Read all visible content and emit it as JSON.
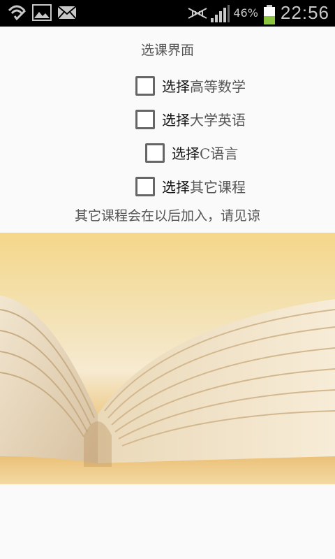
{
  "status_bar": {
    "battery_percent": "46%",
    "time": "22:56",
    "icons": [
      "wifi-check-icon",
      "image-icon",
      "mail-icon",
      "silent-mode-icon",
      "signal-icon",
      "battery-icon"
    ]
  },
  "screen": {
    "title": "选课界面",
    "options": [
      {
        "prefix": "选择",
        "course": "高等数学"
      },
      {
        "prefix": "选择",
        "course": "大学英语"
      },
      {
        "prefix": "选择",
        "course": "C语言"
      },
      {
        "prefix": "选择",
        "course": "其它课程"
      }
    ],
    "note": "其它课程会在以后加入，请见谅"
  },
  "colors": {
    "status_bar_bg": "#000000",
    "background": "#fafafa",
    "battery_green": "#8cc63f"
  }
}
